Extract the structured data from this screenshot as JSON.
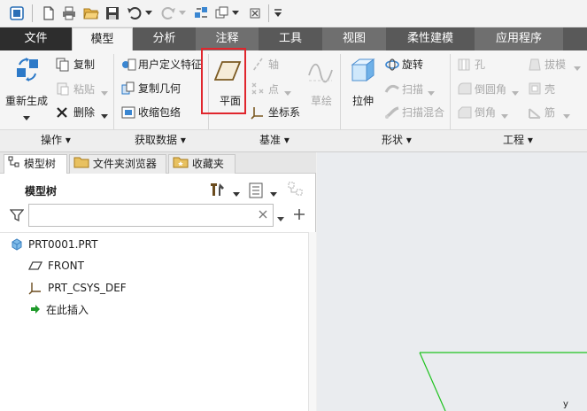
{
  "tabs": {
    "file": "文件",
    "model": "模型",
    "analysis": "分析",
    "annotate": "注释",
    "tools": "工具",
    "view": "视图",
    "flexible": "柔性建模",
    "apps": "应用程序"
  },
  "ribbon": {
    "operations": {
      "regenerate": "重新生成",
      "copy": "复制",
      "paste": "粘贴",
      "delete": "删除",
      "group_label": "操作"
    },
    "get_data": {
      "udf": "用户定义特征",
      "copy_geom": "复制几何",
      "shrinkwrap": "收缩包络",
      "group_label": "获取数据"
    },
    "datum": {
      "plane": "平面",
      "axis": "轴",
      "point": "点",
      "csys": "坐标系",
      "sketch": "草绘",
      "group_label": "基准"
    },
    "shapes": {
      "extrude": "拉伸",
      "revolve": "旋转",
      "sweep": "扫描",
      "swept_blend": "扫描混合",
      "group_label": "形状"
    },
    "engineering": {
      "hole": "孔",
      "draft": "拔模",
      "round": "倒圆角",
      "shell": "壳",
      "chamfer": "倒角",
      "rib": "筋",
      "group_label": "工程"
    }
  },
  "panel": {
    "tabs": {
      "model_tree": "模型树",
      "folder_browser": "文件夹浏览器",
      "favorites": "收藏夹"
    },
    "header": "模型树",
    "search": {
      "value": ""
    },
    "tree": {
      "root": "PRT0001.PRT",
      "front": "FRONT",
      "csys": "PRT_CSYS_DEF",
      "insert_here": "在此插入"
    }
  },
  "graphics": {
    "axis_label": "y"
  },
  "colors": {
    "tab_bar": "#595959",
    "file_tab": "#2d2d2d",
    "highlight": "#e0262d",
    "datum_plane": "#1ec21e"
  }
}
